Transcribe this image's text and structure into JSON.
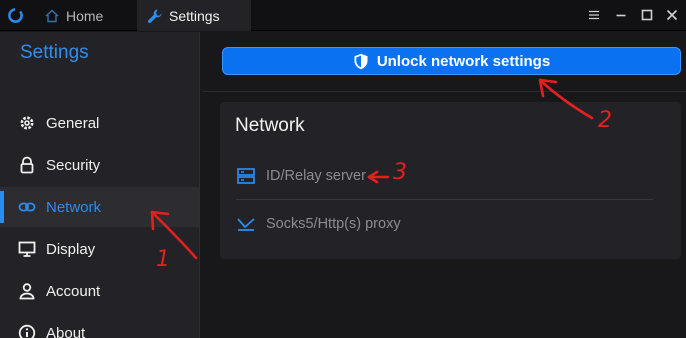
{
  "titlebar": {
    "tabs": [
      {
        "label": "Home",
        "icon": "home-icon"
      },
      {
        "label": "Settings",
        "icon": "wrench-icon"
      }
    ],
    "controls": [
      "menu-icon",
      "minimize-icon",
      "maximize-icon",
      "close-icon"
    ]
  },
  "sidebar": {
    "title": "Settings",
    "items": [
      {
        "label": "General",
        "icon": "gear-icon"
      },
      {
        "label": "Security",
        "icon": "lock-icon"
      },
      {
        "label": "Network",
        "icon": "link-icon",
        "active": true
      },
      {
        "label": "Display",
        "icon": "monitor-icon"
      },
      {
        "label": "Account",
        "icon": "user-icon"
      },
      {
        "label": "About",
        "icon": "info-icon"
      }
    ]
  },
  "main": {
    "unlock_button": {
      "label": "Unlock network settings",
      "icon": "shield-icon"
    },
    "card": {
      "title": "Network",
      "rows": [
        {
          "label": "ID/Relay server",
          "icon": "server-icon"
        },
        {
          "label": "Socks5/Http(s) proxy",
          "icon": "proxy-icon"
        }
      ]
    }
  },
  "annotations": [
    "1",
    "2",
    "3"
  ],
  "colors": {
    "accent": "#2b8cf0",
    "button": "#0a72f0",
    "annotation": "#e32020",
    "background": "#18181a",
    "panel": "#232327"
  }
}
